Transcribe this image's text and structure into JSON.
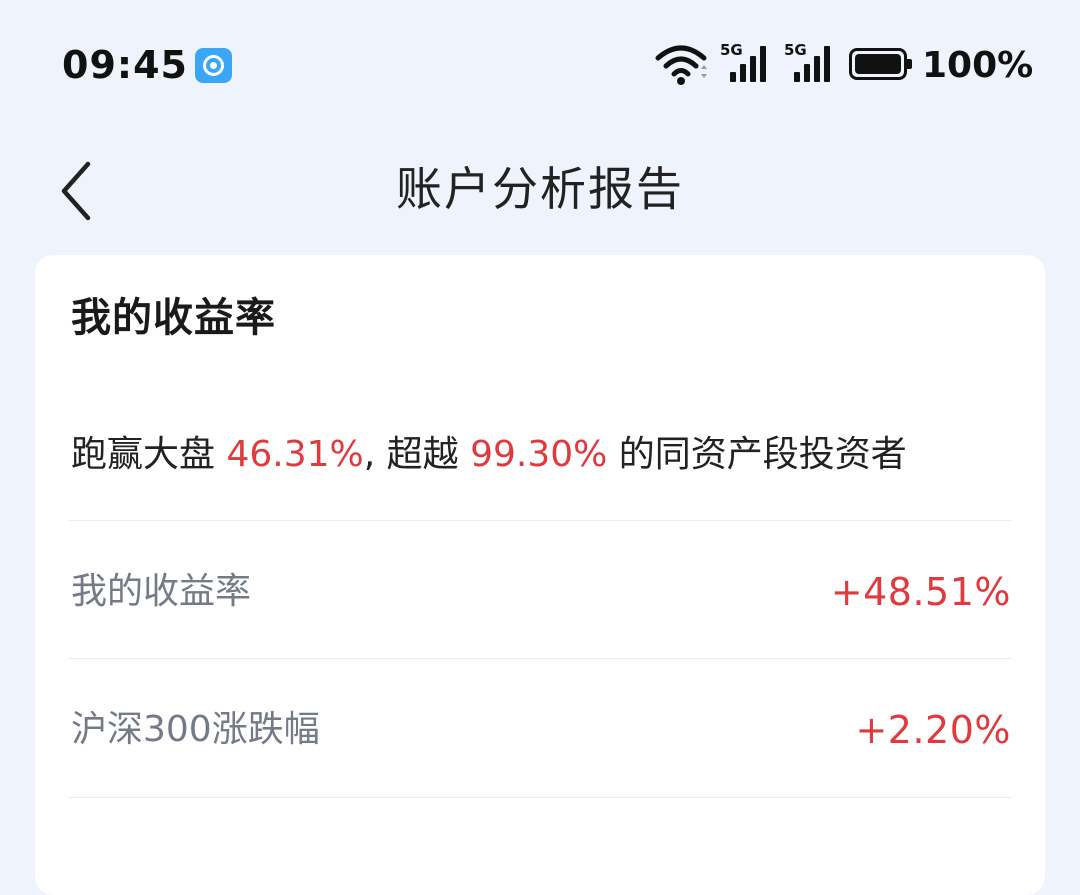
{
  "status_bar": {
    "time": "09:45",
    "signal_1_tag": "5G",
    "signal_2_tag": "5G",
    "battery_percent": "100%",
    "battery_level": 1.0,
    "app_icon": "app-notification-icon"
  },
  "header": {
    "title": "账户分析报告",
    "back_icon": "chevron-left-icon"
  },
  "card": {
    "title": "我的收益率",
    "summary": {
      "prefix": "跑赢大盘 ",
      "beat_market_pct": "46.31%",
      "middle": ", 超越 ",
      "exceed_peers_pct": "99.30%",
      "suffix": " 的同资产段投资者"
    },
    "rows": [
      {
        "label": "我的收益率",
        "value": "+48.51%"
      },
      {
        "label": "沪深300涨跌幅",
        "value": "+2.20%"
      }
    ]
  },
  "colors": {
    "background": "#eef3fc",
    "card": "#ffffff",
    "positive_red": "#e03a3e",
    "label_gray": "#747a86"
  }
}
